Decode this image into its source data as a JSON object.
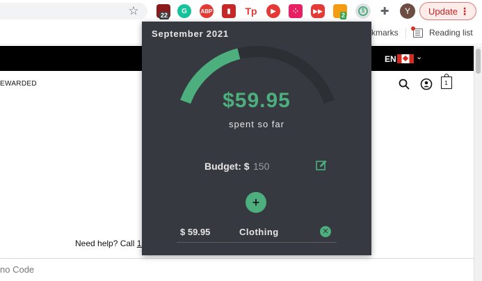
{
  "browser": {
    "extensions": [
      {
        "icon": "shield-ext-icon",
        "badge": "22",
        "color": "#8b1a1a"
      },
      {
        "icon": "grammarly-icon",
        "color": "#15c39a"
      },
      {
        "icon": "abp-icon",
        "label": "ABP",
        "color": "#e53935"
      },
      {
        "icon": "book-icon",
        "color": "#c62828"
      },
      {
        "icon": "tp-icon",
        "label": "Tp",
        "color": "#e53935"
      },
      {
        "icon": "play-icon",
        "color": "#e53935"
      },
      {
        "icon": "dice-icon",
        "color": "#e91e63"
      },
      {
        "icon": "youtube-icon",
        "color": "#e53935"
      },
      {
        "icon": "tool-ext-icon",
        "badge": "2",
        "color": "#f39c12"
      },
      {
        "icon": "budget-ext-icon",
        "color": "#4caf7d"
      },
      {
        "icon": "puzzle-icon",
        "color": "#5f6368"
      }
    ],
    "avatar_letter": "Y",
    "update_label": "Update",
    "bookmarks_partial": "kmarks",
    "reading_list": "Reading list"
  },
  "site": {
    "lang": "EN",
    "rewarded_partial": "EWARDED",
    "cart_count": "1",
    "need_help": "Need help? Call ",
    "need_help_link": "1-",
    "promo_partial": "no Code"
  },
  "popup": {
    "month": "September 2021",
    "amount": "$59.95",
    "spent_label": "spent so far",
    "budget_label": "Budget: $",
    "budget_value": "150",
    "spent_fraction": 0.4,
    "add_label": "+",
    "entries": [
      {
        "amount": "$ 59.95",
        "category": "Clothing"
      }
    ],
    "accent": "#4caf7d"
  }
}
